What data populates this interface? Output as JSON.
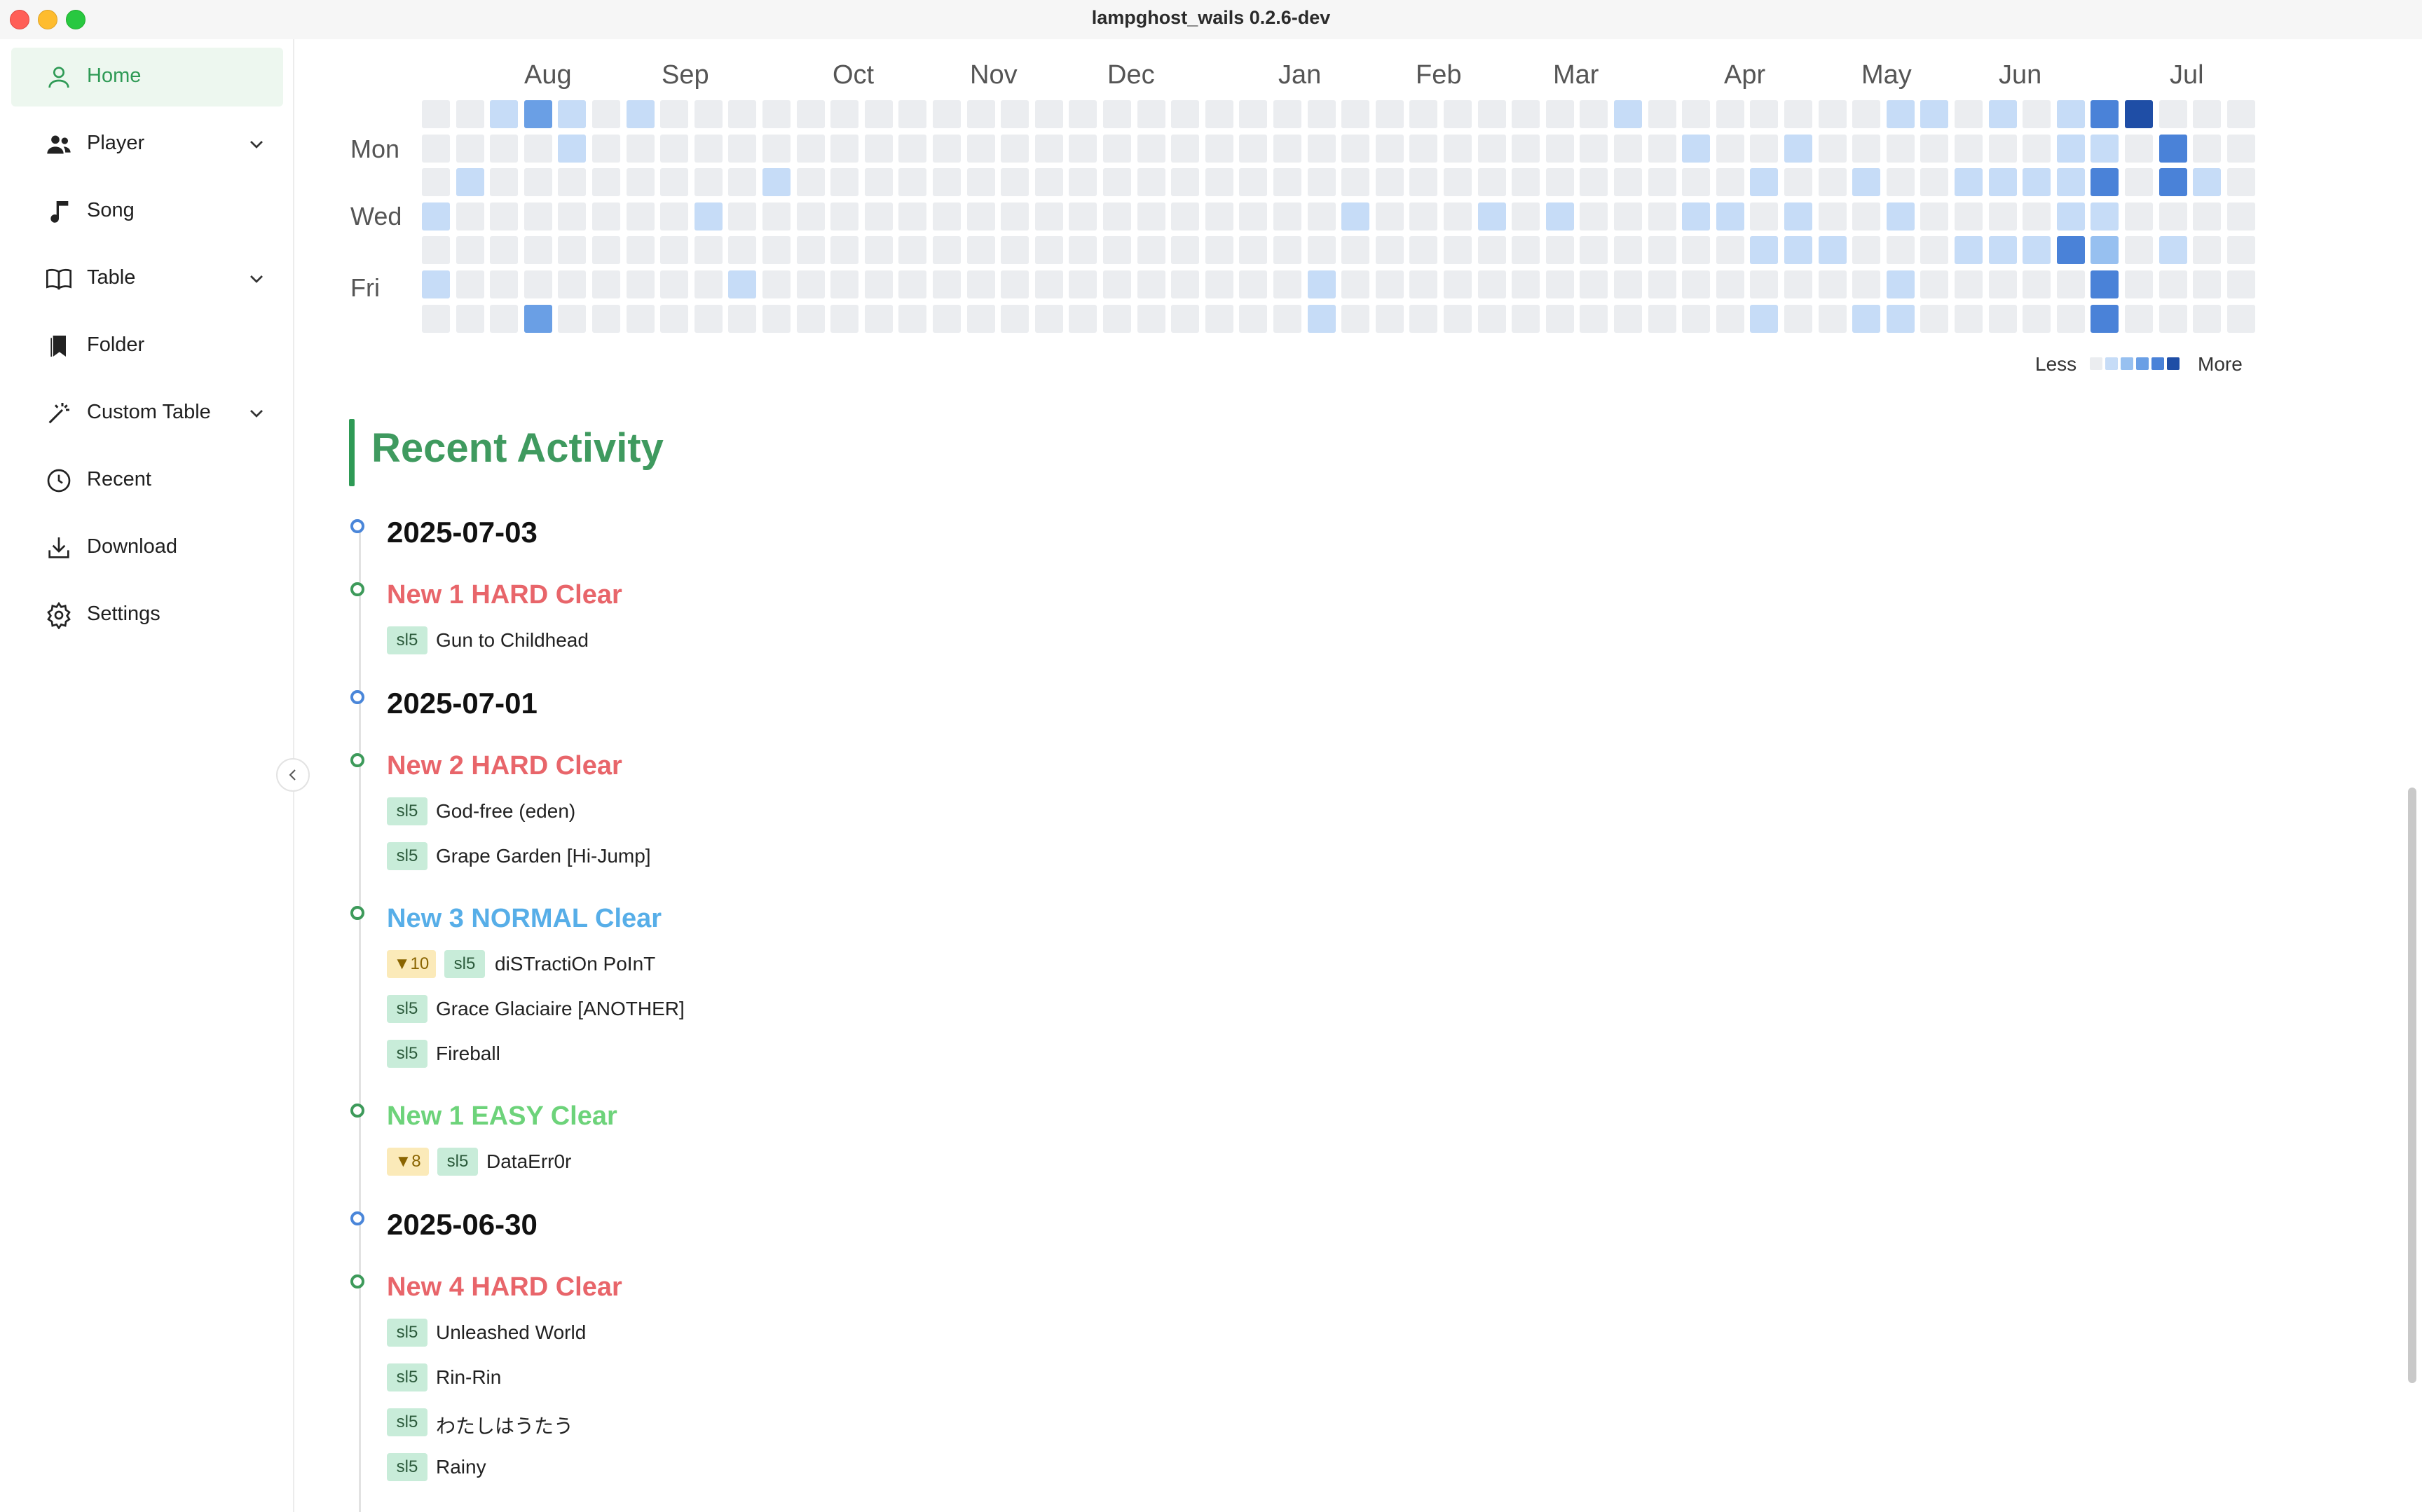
{
  "window": {
    "title": "lampghost_wails 0.2.6-dev"
  },
  "sidebar": {
    "items": [
      {
        "label": "Home",
        "icon": "user-icon",
        "active": true
      },
      {
        "label": "Player",
        "icon": "users-icon",
        "expandable": true
      },
      {
        "label": "Song",
        "icon": "music-note-icon"
      },
      {
        "label": "Table",
        "icon": "book-icon",
        "expandable": true
      },
      {
        "label": "Folder",
        "icon": "bookmark-icon"
      },
      {
        "label": "Custom Table",
        "icon": "magic-wand-icon",
        "expandable": true
      },
      {
        "label": "Recent",
        "icon": "clock-icon"
      },
      {
        "label": "Download",
        "icon": "download-icon"
      },
      {
        "label": "Settings",
        "icon": "gear-icon"
      }
    ],
    "collapse_icon": "chevron-left-icon"
  },
  "heatmap": {
    "months": [
      "Aug",
      "Sep",
      "Oct",
      "Nov",
      "Dec",
      "Jan",
      "Feb",
      "Mar",
      "Apr",
      "May",
      "Jun",
      "Jul"
    ],
    "weekday_labels": [
      "Mon",
      "Wed",
      "Fri"
    ],
    "legend_less": "Less",
    "legend_more": "More",
    "colors": [
      "#ebedf0",
      "#c6dcf7",
      "#97c0f0",
      "#6a9fe5",
      "#4a82d8",
      "#1f4ea6"
    ],
    "weeks": 54,
    "active_cells": [
      [
        2,
        0,
        1
      ],
      [
        3,
        0,
        3
      ],
      [
        4,
        0,
        1
      ],
      [
        4,
        1,
        1
      ],
      [
        6,
        0,
        1
      ],
      [
        1,
        2,
        1
      ],
      [
        0,
        3,
        1
      ],
      [
        0,
        5,
        1
      ],
      [
        3,
        6,
        3
      ],
      [
        8,
        3,
        1
      ],
      [
        9,
        5,
        1
      ],
      [
        10,
        2,
        1
      ],
      [
        27,
        3,
        1
      ],
      [
        26,
        5,
        1
      ],
      [
        26,
        6,
        1
      ],
      [
        31,
        3,
        1
      ],
      [
        33,
        3,
        1
      ],
      [
        35,
        0,
        1
      ],
      [
        37,
        1,
        1
      ],
      [
        37,
        3,
        1
      ],
      [
        38,
        3,
        1
      ],
      [
        39,
        2,
        1
      ],
      [
        39,
        4,
        1
      ],
      [
        39,
        6,
        1
      ],
      [
        40,
        3,
        1
      ],
      [
        40,
        4,
        1
      ],
      [
        41,
        4,
        1
      ],
      [
        40,
        1,
        1
      ],
      [
        42,
        2,
        1
      ],
      [
        42,
        6,
        1
      ],
      [
        43,
        0,
        1
      ],
      [
        43,
        3,
        1
      ],
      [
        43,
        5,
        1
      ],
      [
        43,
        6,
        1
      ],
      [
        44,
        0,
        1
      ],
      [
        45,
        2,
        1
      ],
      [
        45,
        4,
        1
      ],
      [
        46,
        0,
        1
      ],
      [
        46,
        2,
        1
      ],
      [
        46,
        4,
        1
      ],
      [
        47,
        2,
        1
      ],
      [
        47,
        4,
        1
      ],
      [
        48,
        0,
        1
      ],
      [
        48,
        1,
        1
      ],
      [
        48,
        2,
        1
      ],
      [
        48,
        3,
        1
      ],
      [
        48,
        4,
        4
      ],
      [
        49,
        0,
        4
      ],
      [
        49,
        1,
        1
      ],
      [
        49,
        2,
        4
      ],
      [
        49,
        3,
        1
      ],
      [
        49,
        4,
        2
      ],
      [
        49,
        5,
        4
      ],
      [
        49,
        6,
        4
      ],
      [
        50,
        0,
        5
      ],
      [
        51,
        1,
        4
      ],
      [
        51,
        2,
        4
      ],
      [
        51,
        4,
        1
      ],
      [
        52,
        2,
        1
      ]
    ]
  },
  "recent_activity": {
    "title": "Recent Activity",
    "entries": [
      {
        "type": "date",
        "text": "2025-07-03"
      },
      {
        "type": "group",
        "text": "New 1 HARD Clear",
        "lamp": "hard",
        "songs": [
          {
            "tags": [
              "sl5"
            ],
            "name": "Gun to Childhead"
          }
        ]
      },
      {
        "type": "date",
        "text": "2025-07-01"
      },
      {
        "type": "group",
        "text": "New 2 HARD Clear",
        "lamp": "hard",
        "songs": [
          {
            "tags": [
              "sl5"
            ],
            "name": "God-free (eden)"
          },
          {
            "tags": [
              "sl5"
            ],
            "name": "Grape Garden [Hi-Jump]"
          }
        ]
      },
      {
        "type": "group",
        "text": "New 3 NORMAL Clear",
        "lamp": "normal",
        "songs": [
          {
            "drop": "▼10",
            "tags": [
              "sl5"
            ],
            "name": "diSTractiOn PoInT"
          },
          {
            "tags": [
              "sl5"
            ],
            "name": "Grace Glaciaire [ANOTHER]"
          },
          {
            "tags": [
              "sl5"
            ],
            "name": "Fireball"
          }
        ]
      },
      {
        "type": "group",
        "text": "New 1 EASY Clear",
        "lamp": "easy",
        "songs": [
          {
            "drop": "▼8",
            "tags": [
              "sl5"
            ],
            "name": "DataErr0r"
          }
        ]
      },
      {
        "type": "date",
        "text": "2025-06-30"
      },
      {
        "type": "group",
        "text": "New 4 HARD Clear",
        "lamp": "hard",
        "songs": [
          {
            "tags": [
              "sl5"
            ],
            "name": "Unleashed World"
          },
          {
            "tags": [
              "sl5"
            ],
            "name": "Rin-Rin"
          },
          {
            "tags": [
              "sl5"
            ],
            "name": "わたしはうたう"
          },
          {
            "tags": [
              "sl5"
            ],
            "name": "Rainy"
          }
        ]
      }
    ]
  }
}
